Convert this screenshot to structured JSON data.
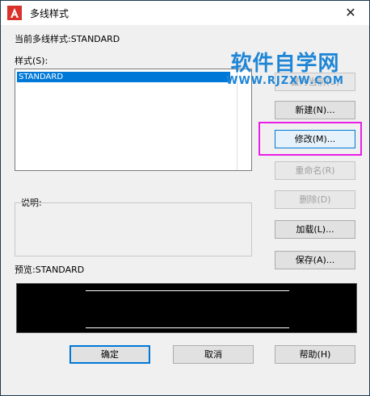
{
  "window": {
    "title": "多线样式",
    "close_glyph": "✕"
  },
  "current_style": {
    "label": "当前多线样式:STANDARD"
  },
  "styles": {
    "label": "样式(S):",
    "items": [
      "STANDARD"
    ]
  },
  "buttons": {
    "set_current": "置为当前(U)",
    "new": "新建(N)...",
    "modify": "修改(M)...",
    "rename": "重命名(R)",
    "delete": "删除(D)",
    "load": "加载(L)...",
    "save": "保存(A)...",
    "ok": "确定",
    "cancel": "取消",
    "help": "帮助(H)"
  },
  "description": {
    "label": "说明:"
  },
  "preview": {
    "label": "预览:STANDARD"
  },
  "watermark": {
    "title": "软件自学网",
    "url": "WWW.RJZXW.COM"
  },
  "colors": {
    "selection": "#0078d7",
    "highlight_box": "#e91ee6",
    "watermark": "#1f86d6",
    "app_icon": "#d9322b"
  }
}
